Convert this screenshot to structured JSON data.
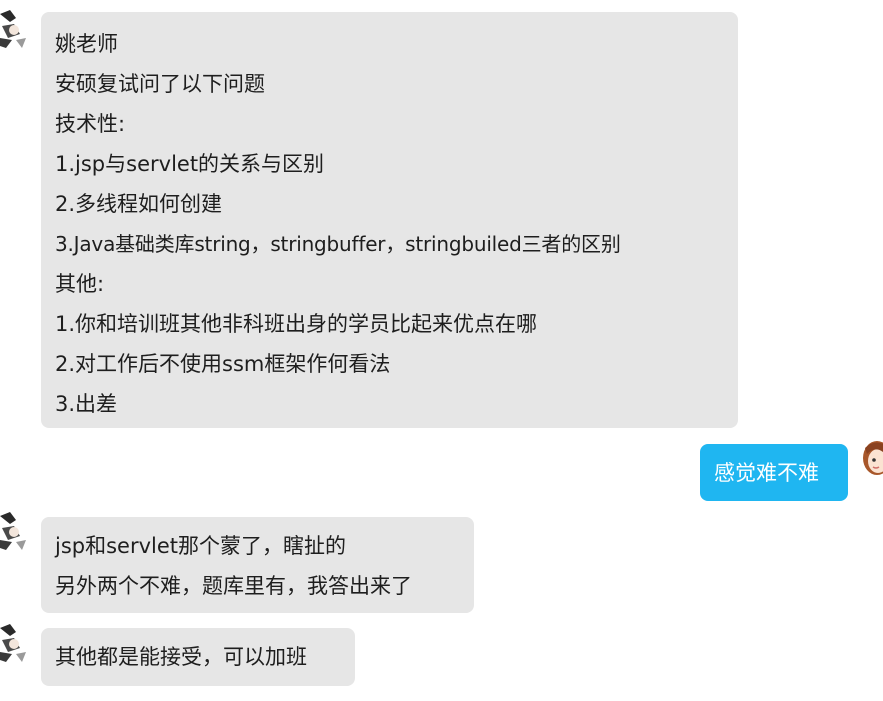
{
  "conversation": {
    "messages": [
      {
        "sender": "other",
        "lines": [
          "姚老师",
          "安硕复试问了以下问题",
          "技术性:",
          "1.jsp与servlet的关系与区别",
          "2.多线程如何创建",
          "3.Java基础类库string，stringbuffer，stringbuiled三者的区别",
          "其他:",
          "1.你和培训班其他非科班出身的学员比起来优点在哪",
          "2.对工作后不使用ssm框架作何看法",
          "3.出差"
        ]
      },
      {
        "sender": "me",
        "lines": [
          "感觉难不难"
        ]
      },
      {
        "sender": "other",
        "lines": [
          "jsp和servlet那个蒙了，瞎扯的",
          "另外两个不难，题库里有，我答出来了"
        ]
      },
      {
        "sender": "other",
        "lines": [
          "其他都是能接受，可以加班"
        ]
      }
    ]
  },
  "colors": {
    "incoming_bubble": "#e6e6e6",
    "outgoing_bubble": "#1fb6f1",
    "incoming_text": "#1e1e1e",
    "outgoing_text": "#ffffff"
  },
  "icons": {
    "other_avatar": "anime-avatar-icon",
    "my_avatar": "girl-avatar-icon"
  }
}
